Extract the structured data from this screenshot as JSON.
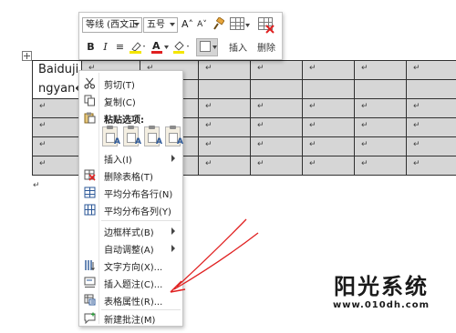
{
  "table": {
    "first_cell": {
      "line1": "Baiduji",
      "line2": "ngyan↵"
    },
    "cell_mark": "↵",
    "after_mark": "↵"
  },
  "toolbar": {
    "font_name": "等线 (西文正",
    "font_size": "五号",
    "grow_font": "A˄",
    "shrink_font": "A˅",
    "bold": "B",
    "italic": "I",
    "align": "≡",
    "font_color_letter": "A",
    "insert_label": "插入",
    "delete_label": "删除"
  },
  "context_menu": {
    "items": [
      {
        "label": "剪切(T)",
        "icon": "cut-icon"
      },
      {
        "label": "复制(C)",
        "icon": "copy-icon"
      },
      {
        "label": "粘贴选项:",
        "icon": "paste-icon"
      },
      {
        "label": "插入(I)",
        "icon": ""
      },
      {
        "label": "删除表格(T)",
        "icon": "delete-table-icon"
      },
      {
        "label": "平均分布各行(N)",
        "icon": "distribute-rows-icon"
      },
      {
        "label": "平均分布各列(Y)",
        "icon": "distribute-columns-icon"
      },
      {
        "label": "边框样式(B)",
        "icon": ""
      },
      {
        "label": "自动调整(A)",
        "icon": ""
      },
      {
        "label": "文字方向(X)...",
        "icon": "text-direction-icon"
      },
      {
        "label": "插入题注(C)...",
        "icon": "insert-caption-icon"
      },
      {
        "label": "表格属性(R)...",
        "icon": "table-properties-icon"
      },
      {
        "label": "新建批注(M)",
        "icon": "new-comment-icon"
      }
    ],
    "paste_options": [
      "A",
      "A",
      "A",
      "A"
    ]
  },
  "watermark": {
    "title": "阳光系统",
    "url": "www.010dh.com"
  },
  "colors": {
    "selection": "#d6d6d6",
    "annotation_arrow": "#e02020",
    "icon_blue": "#2b5797"
  }
}
